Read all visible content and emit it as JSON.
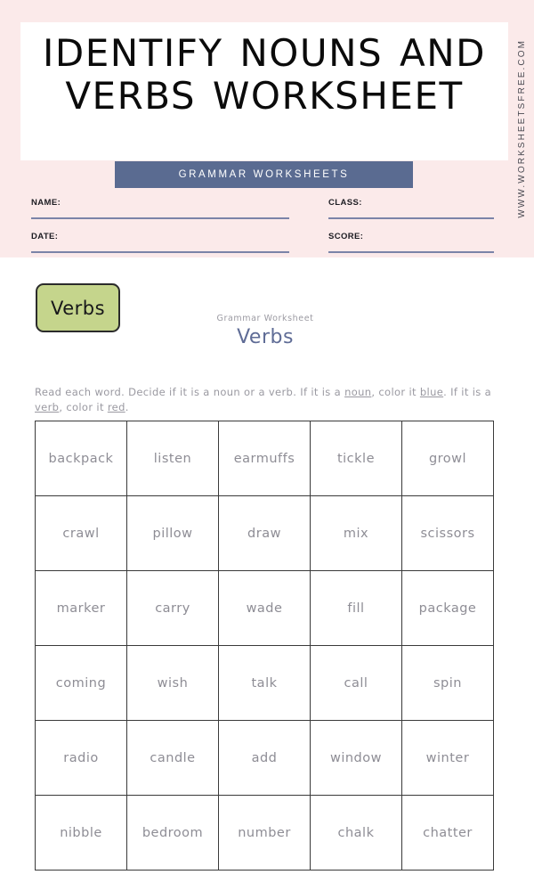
{
  "page": {
    "title": "IDENTIFY NOUNS AND VERBS WORKSHEET",
    "side_url": "WWW.WORKSHEETSFREE.COM",
    "banner_label": "GRAMMAR WORKSHEETS",
    "colors": {
      "pink_background": "#FBEAEA",
      "banner_blue": "#5A6B91",
      "field_line": "#7B84A8",
      "badge_green": "#C5D58C",
      "subtitle_blue": "#5F6C96",
      "body_gray": "#9A99A1",
      "grid_border": "#3A3A3A"
    }
  },
  "fields": [
    {
      "label": "NAME:",
      "value": ""
    },
    {
      "label": "CLASS:",
      "value": ""
    },
    {
      "label": "DATE:",
      "value": ""
    },
    {
      "label": "SCORE:",
      "value": ""
    }
  ],
  "badge": {
    "label": "Verbs"
  },
  "subtitle": {
    "small": "Grammar Worksheet",
    "big": "Verbs"
  },
  "instructions": {
    "part1": "Read each word.  Decide if it is a noun or a verb.  If it is a ",
    "underline1": "noun",
    "part2": ", color it ",
    "underline2": "blue",
    "part3": ". If it is a ",
    "underline3": "verb",
    "part4": ", color it ",
    "underline4": "red",
    "part5": "."
  },
  "word_grid": {
    "rows": [
      [
        "backpack",
        "listen",
        "earmuffs",
        "tickle",
        "growl"
      ],
      [
        "crawl",
        "pillow",
        "draw",
        "mix",
        "scissors"
      ],
      [
        "marker",
        "carry",
        "wade",
        "fill",
        "package"
      ],
      [
        "coming",
        "wish",
        "talk",
        "call",
        "spin"
      ],
      [
        "radio",
        "candle",
        "add",
        "window",
        "winter"
      ],
      [
        "nibble",
        "bedroom",
        "number",
        "chalk",
        "chatter"
      ]
    ]
  }
}
